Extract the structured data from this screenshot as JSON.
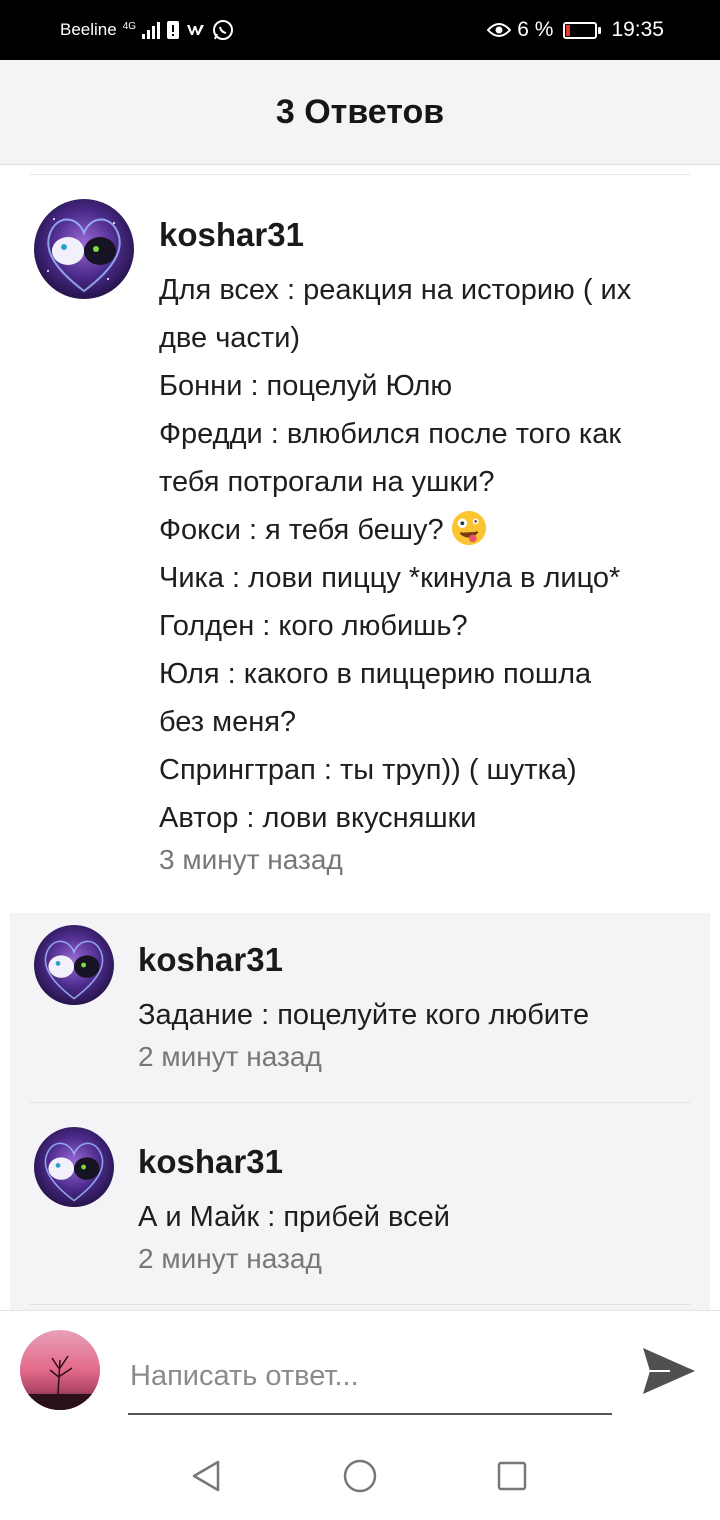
{
  "status_bar": {
    "carrier": "Beeline",
    "network": "4G",
    "battery_percent": "6 %",
    "time": "19:35"
  },
  "header": {
    "title": "3 Ответов"
  },
  "main_comment": {
    "username": "koshar31",
    "lines": [
      "Для всех : реакция на историю ( их",
      "две части)",
      "Бонни : поцелуй Юлю",
      "Фредди : влюбился после того как",
      "тебя потрогали на ушки?",
      "Фокси : я тебя бешу?",
      "Чика : лови пиццу *кинула в лицо*",
      "Голден : кого любишь?",
      "Юля : какого в пиццерию пошла",
      "без меня?",
      "Спрингтрап : ты труп)) ( шутка)",
      "Автор : лови вкусняшки"
    ],
    "emoji": "zany-face-emoji",
    "timestamp": "3 минут назад"
  },
  "replies": [
    {
      "username": "koshar31",
      "text": "Задание : поцелуйте кого любите",
      "timestamp": "2 минут назад"
    },
    {
      "username": "koshar31",
      "text": "А и Майк : прибей всей",
      "timestamp": "2 минут назад"
    }
  ],
  "composer": {
    "placeholder": "Написать ответ...",
    "send_icon": "send-icon"
  },
  "nav": {
    "back_icon": "back-triangle-icon",
    "home_icon": "home-circle-icon",
    "recents_icon": "recents-square-icon"
  }
}
